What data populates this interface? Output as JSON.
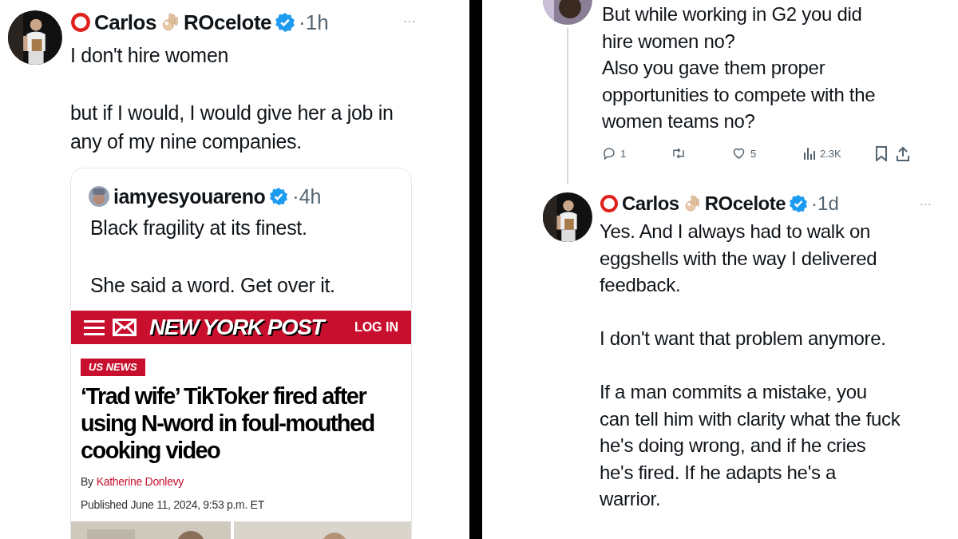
{
  "left_tweet": {
    "name_first": "Carlos",
    "name_last": "ROcelote",
    "verified": true,
    "time": "·1h",
    "more": "···",
    "paragraphs": [
      "I don't hire women",
      "but if I would, I would give her a job in any of my nine companies."
    ],
    "quote": {
      "author": "iamyesyouareno",
      "verified": true,
      "time": "·4h",
      "paragraphs": [
        "Black fragility at its finest.",
        "She said a word. Get over it."
      ],
      "article": {
        "site": "NEW YORK POST",
        "login": "LOG IN",
        "section": "US NEWS",
        "headline": "‘Trad wife’ TikToker fired after using N-word in foul-mouthed cooking video",
        "byline_prefix": "By",
        "author": "Katherine Donlevy",
        "published": "Published June 11, 2024, 9:53 p.m. ET"
      }
    }
  },
  "right_thread": {
    "reply": {
      "paragraphs": [
        "But while working in G2 you did hire women no?",
        "Also you gave them proper opportunities to compete with the women teams no?"
      ],
      "actions": [
        {
          "kind": "reply",
          "count": "1"
        },
        {
          "kind": "repost"
        },
        {
          "kind": "like",
          "count": "5"
        },
        {
          "kind": "views",
          "count": "2.3K"
        },
        {
          "kind": "bookmark"
        },
        {
          "kind": "share"
        }
      ]
    },
    "tweet": {
      "name_first": "Carlos",
      "name_last": "ROcelote",
      "verified": true,
      "time": "·1d",
      "more": "···",
      "paragraphs": [
        "Yes. And I always had to walk on eggshells with the way I delivered feedback.",
        "I don't want that problem anymore.",
        "If a man commits a mistake, you can tell him with clarity what the fuck he's doing wrong, and if he cries he's fired. If he adapts he's a warrior."
      ]
    }
  }
}
